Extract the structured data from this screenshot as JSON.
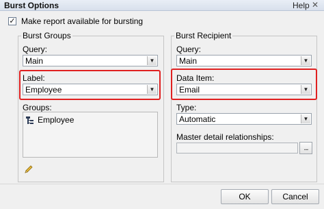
{
  "window": {
    "title": "Burst Options",
    "help_label": "Help",
    "close_glyph": "✕"
  },
  "make_available": {
    "label": "Make report available for bursting",
    "checked": true,
    "check_glyph": "✓"
  },
  "burst_groups": {
    "legend": "Burst Groups",
    "query_label": "Query:",
    "query_value": "Main",
    "label_label": "Label:",
    "label_value": "Employee",
    "groups_label": "Groups:",
    "groups_items": [
      "Employee"
    ],
    "edit_icon": "pencil-icon"
  },
  "burst_recipient": {
    "legend": "Burst Recipient",
    "query_label": "Query:",
    "query_value": "Main",
    "data_item_label": "Data Item:",
    "data_item_value": "Email",
    "type_label": "Type:",
    "type_value": "Automatic",
    "master_detail_label": "Master detail relationships:",
    "master_detail_value": "",
    "ellipsis_label": "..."
  },
  "footer": {
    "ok_label": "OK",
    "cancel_label": "Cancel"
  },
  "highlight_color": "#e02020",
  "dropdown_glyph": "▼"
}
